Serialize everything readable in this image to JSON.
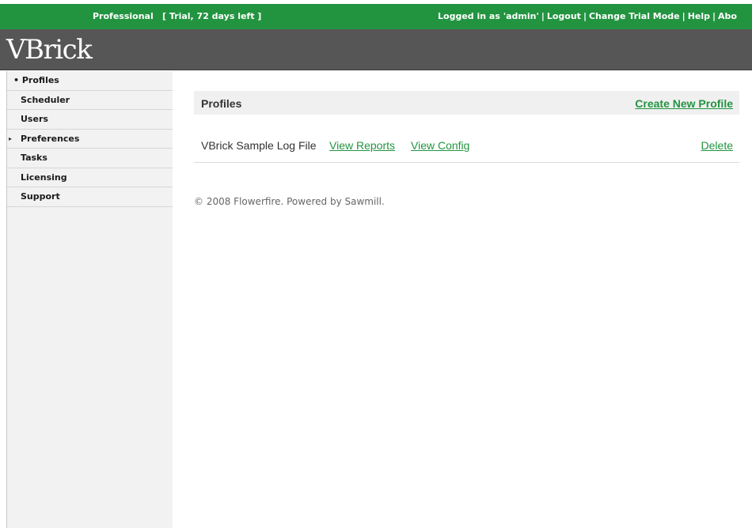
{
  "topbar": {
    "edition": "Professional",
    "trial": "[ Trial, 72 days left ]",
    "logged_in": "Logged in as 'admin'",
    "links": [
      "Logout",
      "Change Trial Mode",
      "Help",
      "Abo"
    ]
  },
  "banner": {
    "logo": "VBrick"
  },
  "sidebar": {
    "items": [
      {
        "label": "Profiles",
        "marker": "•"
      },
      {
        "label": "Scheduler"
      },
      {
        "label": "Users"
      },
      {
        "label": "Preferences",
        "marker": "▸"
      },
      {
        "label": "Tasks"
      },
      {
        "label": "Licensing"
      },
      {
        "label": "Support"
      }
    ]
  },
  "main": {
    "title": "Profiles",
    "create_label": "Create New Profile",
    "profiles": [
      {
        "name": "VBrick Sample Log File",
        "view_reports": "View Reports",
        "view_config": "View Config",
        "delete": "Delete"
      }
    ]
  },
  "footer": {
    "text": "© 2008 Flowerfire. Powered by Sawmill."
  },
  "colors": {
    "brand_green": "#229440",
    "banner_gray": "#565656",
    "sidebar_bg": "#f2f2f2"
  }
}
